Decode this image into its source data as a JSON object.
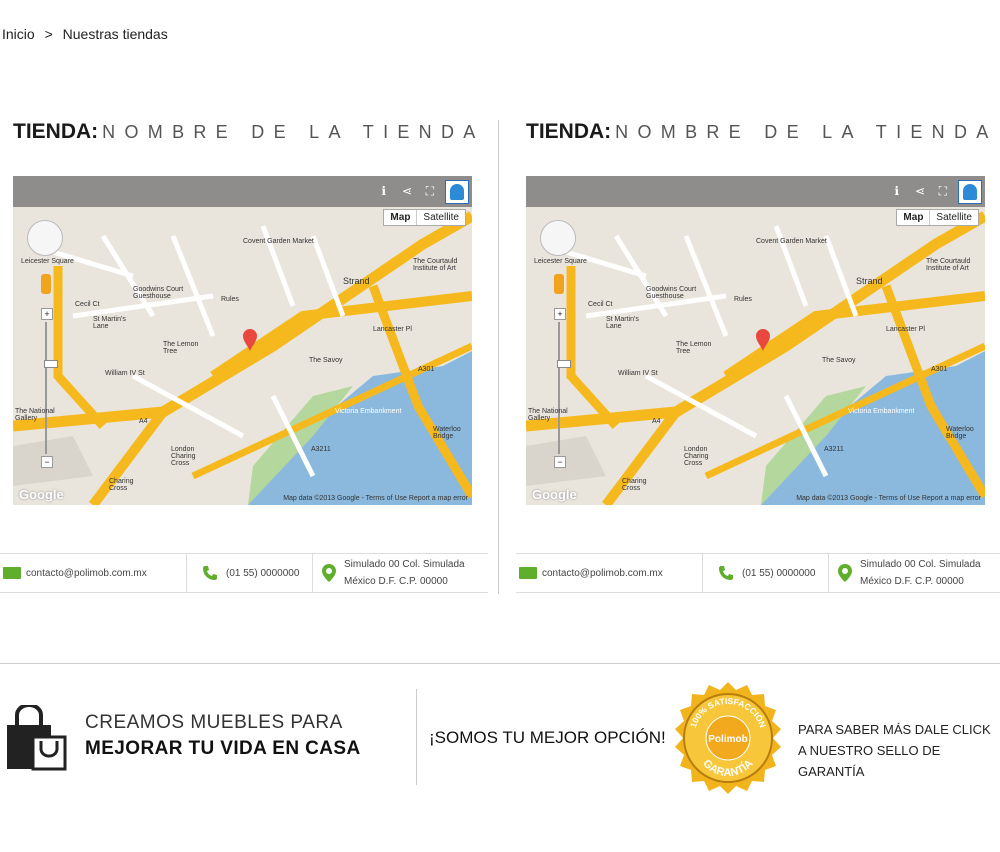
{
  "breadcrumb": {
    "home": "Inicio",
    "separator": ">",
    "current": "Nuestras tiendas"
  },
  "stores": [
    {
      "title_label": "TIENDA:",
      "title_name": "NOMBRE DE LA TIENDA",
      "map": {
        "map_button": "Map",
        "satellite_button": "Satellite",
        "attribution": "Map data ©2013 Google - Terms of Use  Report a map error",
        "logo": "Google"
      },
      "email": "contacto@polimob.com.mx",
      "phone": "(01 55) 0000000",
      "address_line1": "Simulado 00 Col. Simulada",
      "address_line2": "México D.F. C.P. 00000"
    },
    {
      "title_label": "TIENDA:",
      "title_name": "NOMBRE DE LA TIENDA",
      "map": {
        "map_button": "Map",
        "satellite_button": "Satellite",
        "attribution": "Map data ©2013 Google - Terms of Use  Report a map error",
        "logo": "Google"
      },
      "email": "contacto@polimob.com.mx",
      "phone": "(01 55) 0000000",
      "address_line1": "Simulado 00 Col. Simulada",
      "address_line2": "México D.F. C.P. 00000"
    }
  ],
  "map_labels": [
    "Leicester Square",
    "Covent Garden Market",
    "The Courtauld Institute of Art",
    "Goodwins Court Guesthouse",
    "Rules",
    "Cecil Ct",
    "St Martin's Lane",
    "The Lemon Tree",
    "William IV St",
    "Strand",
    "The Savoy",
    "A4",
    "Victoria Embankment",
    "London Charing Cross",
    "Charing Cross",
    "The National Gallery",
    "Lancaster Pl",
    "Waterloo Bridge",
    "A301",
    "A3211"
  ],
  "footer": {
    "tagline_line1": "CREAMOS MUEBLES PARA",
    "tagline_line2": "MEJORAR TU VIDA EN CASA",
    "slogan": "¡SOMOS TU MEJOR OPCIÓN!",
    "seal_top": "100% SATISFACCIÓN",
    "seal_brand": "Polimob",
    "seal_bottom": "GARANTÍA",
    "cta_line1": "PARA SABER MÁS DALE CLICK",
    "cta_line2": "A NUESTRO SELLO DE GARANTÍA"
  },
  "colors": {
    "accent_green": "#5fae2c",
    "map_road": "#f6b91d",
    "map_water": "#8bb9dd",
    "map_park": "#b3d79c",
    "seal_gold": "#f2b41d"
  },
  "icons": [
    "email-icon",
    "phone-icon",
    "location-pin-icon",
    "shopping-bag-icon",
    "guarantee-seal-icon"
  ]
}
